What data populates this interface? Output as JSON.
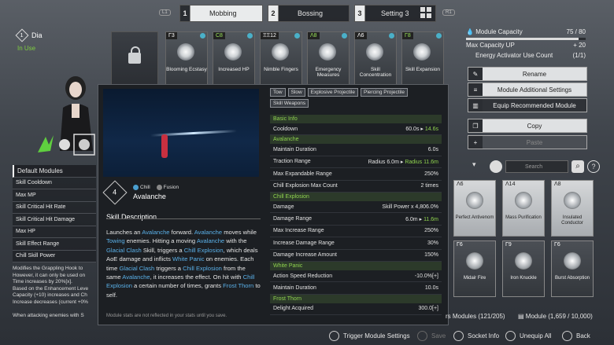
{
  "tabs": [
    {
      "num": "1",
      "label": "Mobbing",
      "active": true
    },
    {
      "num": "2",
      "label": "Bossing",
      "active": false
    },
    {
      "num": "3",
      "label": "Setting 3",
      "active": false
    }
  ],
  "shoulder_left": "L1",
  "shoulder_right": "R1",
  "character": {
    "num": "1",
    "name": "Dia",
    "status": "In Use"
  },
  "equipped_modules": [
    {
      "cost": "Γ3",
      "label": "Blooming Ecstasy"
    },
    {
      "cost": "C8",
      "label": "Increased HP",
      "green": true
    },
    {
      "cost": "ΞΞ12",
      "label": "Nimble Fingers"
    },
    {
      "cost": "Λ8",
      "label": "Emergency Measures",
      "green": true
    },
    {
      "cost": "Λ6",
      "label": "Skill Concentration"
    },
    {
      "cost": "Γ8",
      "label": "Skill Expansion",
      "green": true
    }
  ],
  "capacity": {
    "label": "Module Capacity",
    "value": "75 / 80"
  },
  "max_capacity": {
    "label": "Max Capacity UP",
    "value": "+ 20"
  },
  "energy": {
    "label": "Energy Activator Use Count",
    "value": "(1/1)"
  },
  "right_buttons": {
    "rename": "Rename",
    "additional": "Module Additional Settings",
    "equip": "Equip Recommended Module",
    "copy": "Copy",
    "paste": "Paste"
  },
  "left_list": {
    "header": "Default Modules",
    "items": [
      "Skill Cooldown",
      "Max MP",
      "Skill Critical Hit Rate",
      "Skill Critical Hit Damage",
      "Max HP",
      "Skill Effect Range",
      "Chill Skill Power"
    ]
  },
  "left_desc": [
    "Modifies the Grappling Hook to",
    "However, it can only be used on",
    "Time increases by 20%[x].",
    "Based on the Enhancement Leve",
    "Capacity (+10) increases and Ch",
    "Increase decreases (current +0%",
    "",
    "When attacking enemies with S"
  ],
  "popup": {
    "skill_num": "4",
    "tag1": "Chill",
    "tag2": "Fusion",
    "skill_name": "Avalanche",
    "desc_title": "Skill Description",
    "desc_parts": [
      [
        "Launches an ",
        0
      ],
      [
        "Avalanche",
        1
      ],
      [
        " forward. ",
        0
      ],
      [
        "Avalanche",
        1
      ],
      [
        " moves while ",
        0
      ],
      [
        "Towing",
        1
      ],
      [
        " enemies. Hitting a moving ",
        0
      ],
      [
        "Avalanche",
        1
      ],
      [
        " with the ",
        0
      ],
      [
        "Glacial Clash",
        1
      ],
      [
        " Skill, triggers a ",
        0
      ],
      [
        "Chill Explosion",
        1
      ],
      [
        ", which deals AoE damage and inflicts ",
        0
      ],
      [
        "White Panic",
        1
      ],
      [
        " on enemies. Each time ",
        0
      ],
      [
        "Glacial Clash",
        1
      ],
      [
        " triggers a ",
        0
      ],
      [
        "Chill Explosion",
        1
      ],
      [
        " from the same ",
        0
      ],
      [
        "Avalanche",
        1
      ],
      [
        ", it increases the effect. On hit with ",
        0
      ],
      [
        "Chill Explosion",
        1
      ],
      [
        " a certain number of times, grants ",
        0
      ],
      [
        "Frost Thorn",
        1
      ],
      [
        " to self.",
        0
      ]
    ],
    "disclaimer": "Module stats are not reflected in your stats until you save.",
    "keywords": [
      "Tow",
      "Slow",
      "Explosive Projectile",
      "Piercing Projectile",
      "Skill Weapons"
    ],
    "stats": [
      {
        "section": "Basic Info"
      },
      {
        "label": "Cooldown",
        "value": "60.0s",
        "new": "14.6s"
      },
      {
        "section": "Avalanche"
      },
      {
        "label": "Maintain Duration",
        "value": "6.0s"
      },
      {
        "label": "Traction Range",
        "value": "Radius 6.0m",
        "new": "Radius 11.6m"
      },
      {
        "label": "Max Expandable Range",
        "value": "250%"
      },
      {
        "label": "Chill Explosion Max Count",
        "value": "2 times"
      },
      {
        "section": "Chill Explosion"
      },
      {
        "label": "Damage",
        "value": "Skill Power x 4,806.0%"
      },
      {
        "label": "Damage Range",
        "value": "6.0m",
        "new": "11.6m"
      },
      {
        "label": "Max Increase Range",
        "value": "250%"
      },
      {
        "label": "Increase Damage Range",
        "value": "30%"
      },
      {
        "label": "Damage Increase Amount",
        "value": "150%"
      },
      {
        "section": "White Panic"
      },
      {
        "label": "Action Speed Reduction",
        "value": "-10.0%[+]"
      },
      {
        "label": "Maintain Duration",
        "value": "10.0s"
      },
      {
        "section": "Frost Thorn"
      },
      {
        "label": "Delight Acquired",
        "value": "300.0[+]"
      }
    ]
  },
  "search_placeholder": "Search",
  "grid_modules": [
    {
      "cost": "Λ6",
      "label": "Perfect Antivenom"
    },
    {
      "cost": "Λ14",
      "label": "Mass Purification"
    },
    {
      "cost": "Λ8",
      "label": "Insulated Conductor"
    },
    {
      "cost": "Γ6",
      "label": "Midair Fire",
      "dark": true
    },
    {
      "cost": "Γ9",
      "label": "Iron Knuckle",
      "dark": true
    },
    {
      "cost": "Γ6",
      "label": "Burst Absorption",
      "dark": true
    }
  ],
  "counts": {
    "modules_label": "rs Modules (121/205)",
    "module_total": "Module (1,659 / 10,000)"
  },
  "bottom": {
    "trigger": "Trigger Module Settings",
    "save": "Save",
    "socket": "Socket Info",
    "unequip": "Unequip All",
    "back": "Back"
  }
}
